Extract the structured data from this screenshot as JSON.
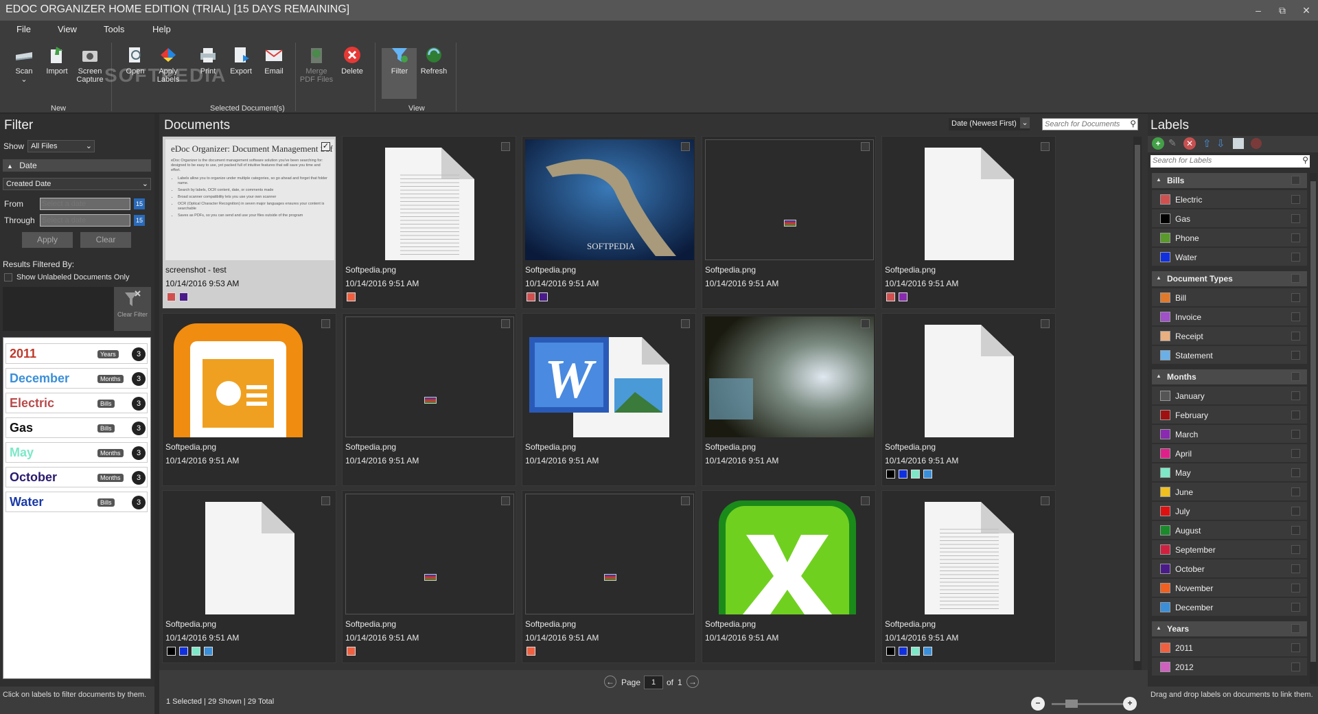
{
  "window": {
    "title": "EDOC ORGANIZER HOME EDITION (TRIAL) [15 DAYS REMAINING]",
    "minimize": "–",
    "restore": "⧉",
    "close": "✕"
  },
  "menu": [
    "File",
    "View",
    "Tools",
    "Help"
  ],
  "ribbon": {
    "scan": "Scan",
    "import": "Import",
    "screen_capture": "Screen Capture",
    "open": "Open",
    "apply_labels": "Apply Labels",
    "print": "Print",
    "export": "Export",
    "email": "Email",
    "merge_pdf": "Merge PDF Files",
    "delete": "Delete",
    "filter": "Filter",
    "refresh": "Refresh",
    "group_new": "New",
    "group_selected": "Selected Document(s)",
    "group_view": "View",
    "watermark": "SOFTPEDIA"
  },
  "filter": {
    "title": "Filter",
    "show_label": "Show",
    "show_value": "All Files",
    "date_section": "Date",
    "date_field": "Created Date",
    "from_label": "From",
    "through_label": "Through",
    "from_placeholder": "Select a date",
    "through_placeholder": "Select a date",
    "calendar_day": "15",
    "apply": "Apply",
    "clear": "Clear",
    "results_by": "Results Filtered By:",
    "unlabeled": "Show Unlabeled Documents Only",
    "clear_filter": "Clear Filter",
    "items": [
      {
        "name": "2011",
        "tag": "Years",
        "count": "3",
        "color": "#c0392b"
      },
      {
        "name": "December",
        "tag": "Months",
        "count": "3",
        "color": "#3a8fd8"
      },
      {
        "name": "Electric",
        "tag": "Bills",
        "count": "3",
        "color": "#b84a4a"
      },
      {
        "name": "Gas",
        "tag": "Bills",
        "count": "3",
        "color": "#111111"
      },
      {
        "name": "May",
        "tag": "Months",
        "count": "3",
        "color": "#7de8c8"
      },
      {
        "name": "October",
        "tag": "Months",
        "count": "3",
        "color": "#2a1a6e"
      },
      {
        "name": "Water",
        "tag": "Bills",
        "count": "3",
        "color": "#1a3aa8"
      }
    ],
    "footer": "Click on labels to filter documents by them."
  },
  "documents": {
    "title": "Documents",
    "sort": "Date (Newest First)",
    "search_placeholder": "Search for Documents",
    "tiles": [
      {
        "name": "screenshot - test",
        "date": "10/14/2016 9:53 AM",
        "thumb": "doc-preview",
        "selected": true,
        "swatches": [
          "#d05050",
          "#4a1a8a"
        ],
        "preview_title": "eDoc Organizer: Document Management Sof",
        "preview_text": "eDoc Organizer is the document management software solution you've been searching for: designed to be easy to use, yet packed full of intuitive features that will save you time and effort.",
        "preview_bullets": [
          "Labels allow you to organize under multiple categories, so go ahead and forget that folder name.",
          "Search by labels, OCR content, date, or comments made",
          "Broad scanner compatibility lets you use your own scanner",
          "OCR (Optical Character Recognition) in seven major languages ensures your content is searchable",
          "Saves as PDFs, so you can send and use your files outside of the program"
        ]
      },
      {
        "name": "Softpedia.png",
        "date": "10/14/2016 9:51 AM",
        "thumb": "lined-page",
        "swatches": [
          "#f06040"
        ]
      },
      {
        "name": "Softpedia.png",
        "date": "10/14/2016 9:51 AM",
        "thumb": "ocean-photo",
        "thumb_text": "SOFTPEDIA",
        "swatches": [
          "#d05050",
          "#4a1a8a"
        ]
      },
      {
        "name": "Softpedia.png",
        "date": "10/14/2016 9:51 AM",
        "thumb": "small-icon",
        "swatches": []
      },
      {
        "name": "Softpedia.png",
        "date": "10/14/2016 9:51 AM",
        "thumb": "blank-page",
        "swatches": [
          "#d05050",
          "#8a2ab0"
        ]
      },
      {
        "name": "Softpedia.png",
        "date": "10/14/2016 9:51 AM",
        "thumb": "powerpoint-icon",
        "swatches": []
      },
      {
        "name": "Softpedia.png",
        "date": "10/14/2016 9:51 AM",
        "thumb": "small-icon",
        "swatches": []
      },
      {
        "name": "Softpedia.png",
        "date": "10/14/2016 9:51 AM",
        "thumb": "word-icon",
        "thumb_text": "W",
        "swatches": []
      },
      {
        "name": "Softpedia.png",
        "date": "10/14/2016 9:51 AM",
        "thumb": "blur-photo",
        "swatches": []
      },
      {
        "name": "Softpedia.png",
        "date": "10/14/2016 9:51 AM",
        "thumb": "blank-page",
        "swatches": [
          "#000000",
          "#1030e0",
          "#7de8c8",
          "#3a8fd8"
        ]
      },
      {
        "name": "Softpedia.png",
        "date": "10/14/2016 9:51 AM",
        "thumb": "blank-page",
        "swatches": [
          "#000000",
          "#1030e0",
          "#7de8c8",
          "#3a8fd8"
        ]
      },
      {
        "name": "Softpedia.png",
        "date": "10/14/2016 9:51 AM",
        "thumb": "small-icon",
        "swatches": [
          "#f06040"
        ]
      },
      {
        "name": "Softpedia.png",
        "date": "10/14/2016 9:51 AM",
        "thumb": "small-icon",
        "swatches": [
          "#f06040"
        ]
      },
      {
        "name": "Softpedia.png",
        "date": "10/14/2016 9:51 AM",
        "thumb": "excel-icon",
        "swatches": []
      },
      {
        "name": "Softpedia.png",
        "date": "10/14/2016 9:51 AM",
        "thumb": "lined-page",
        "swatches": [
          "#000000",
          "#1030e0",
          "#7de8c8",
          "#3a8fd8"
        ]
      }
    ],
    "page_label": "Page",
    "page_value": "1",
    "of_label": "of",
    "page_total": "1",
    "status": "1 Selected | 29 Shown | 29 Total"
  },
  "labels": {
    "title": "Labels",
    "search_placeholder": "Search for Labels",
    "sections": [
      {
        "name": "Bills",
        "items": [
          {
            "name": "Electric",
            "color": "#d05050"
          },
          {
            "name": "Gas",
            "color": "#000000"
          },
          {
            "name": "Phone",
            "color": "#5a9a2a"
          },
          {
            "name": "Water",
            "color": "#1030e0"
          }
        ]
      },
      {
        "name": "Document Types",
        "items": [
          {
            "name": "Bill",
            "color": "#e07a2a"
          },
          {
            "name": "Invoice",
            "color": "#a050c8"
          },
          {
            "name": "Receipt",
            "color": "#e8b080"
          },
          {
            "name": "Statement",
            "color": "#6ab0e8"
          }
        ]
      },
      {
        "name": "Months",
        "items": [
          {
            "name": "January",
            "color": "#555555"
          },
          {
            "name": "February",
            "color": "#a01010"
          },
          {
            "name": "March",
            "color": "#8a2ab0"
          },
          {
            "name": "April",
            "color": "#e0208a"
          },
          {
            "name": "May",
            "color": "#7de8c8"
          },
          {
            "name": "June",
            "color": "#f0c020"
          },
          {
            "name": "July",
            "color": "#e01010"
          },
          {
            "name": "August",
            "color": "#1a8a2a"
          },
          {
            "name": "September",
            "color": "#d02040"
          },
          {
            "name": "October",
            "color": "#4a1a8a"
          },
          {
            "name": "November",
            "color": "#f06020"
          },
          {
            "name": "December",
            "color": "#3a8fd8"
          }
        ]
      },
      {
        "name": "Years",
        "items": [
          {
            "name": "2011",
            "color": "#f06040"
          },
          {
            "name": "2012",
            "color": "#d060c0"
          }
        ]
      }
    ],
    "footer": "Drag and drop labels on documents to link them."
  }
}
